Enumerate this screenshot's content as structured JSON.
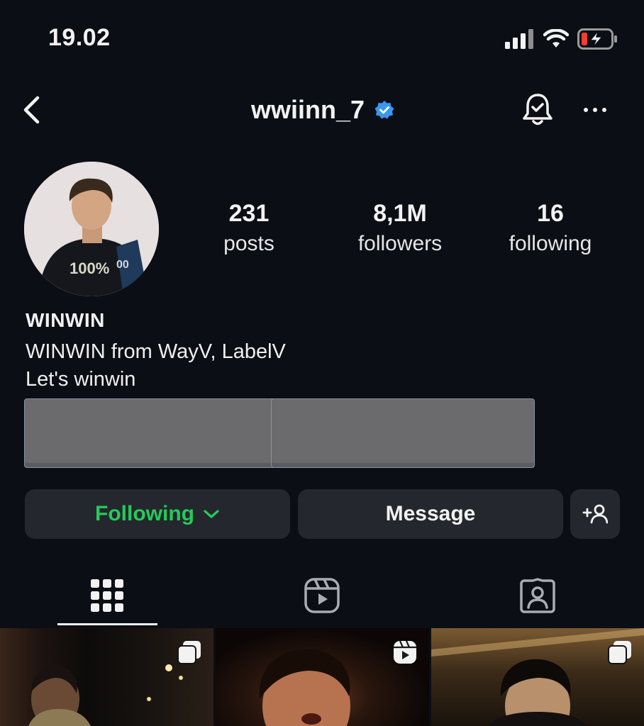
{
  "status_bar": {
    "time": "19.02"
  },
  "header": {
    "username": "wwiinn_7"
  },
  "profile": {
    "stats": {
      "posts": {
        "value": "231",
        "label": "posts"
      },
      "followers": {
        "value": "8,1M",
        "label": "followers"
      },
      "following": {
        "value": "16",
        "label": "following"
      }
    },
    "display_name": "WINWIN",
    "bio": [
      "WINWIN from WayV, LabelV",
      "Let's winwin"
    ]
  },
  "actions": {
    "following_label": "Following",
    "message_label": "Message"
  },
  "colors": {
    "background": "#0b0e14",
    "button": "#24272d",
    "following_green": "#26c95a",
    "verified_blue": "#3897f0",
    "battery_red": "#ff3b30"
  },
  "icons": [
    "signal-icon",
    "wifi-icon",
    "battery-icon",
    "back-icon",
    "verified-icon",
    "bell-icon",
    "more-icon",
    "chevron-down-icon",
    "add-user-icon",
    "grid-icon",
    "reels-icon",
    "tagged-icon",
    "carousel-icon"
  ],
  "tabs": {
    "active": "grid"
  }
}
